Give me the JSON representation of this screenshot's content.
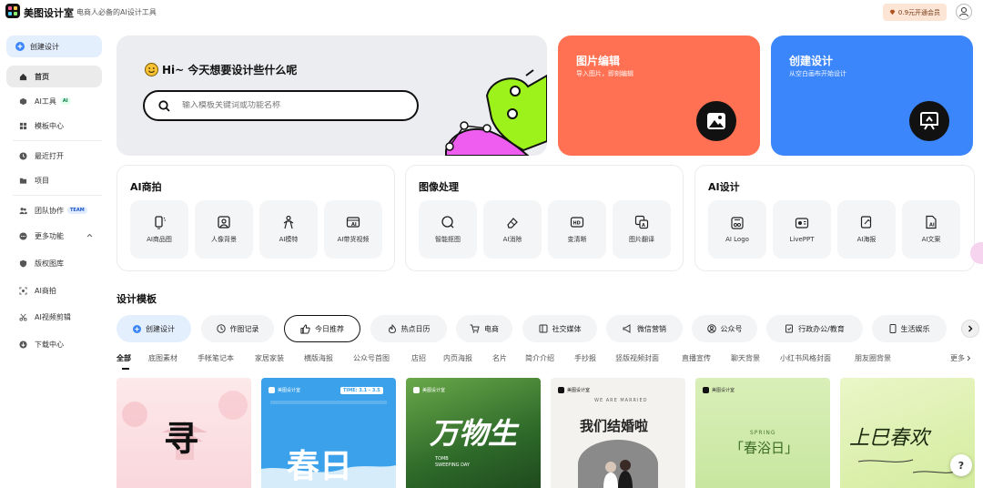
{
  "topbar": {
    "brand": "美图设计室",
    "slogan": "电商人必备的AI设计工具",
    "vip_label": "0.9元开通会员"
  },
  "sidebar": {
    "create_label": "创建设计",
    "items": [
      {
        "label": "首页",
        "icon": "home-icon"
      },
      {
        "label": "AI工具",
        "icon": "cube-icon",
        "tag": "AI"
      },
      {
        "label": "模板中心",
        "icon": "grid-icon"
      },
      {
        "label": "最近打开",
        "icon": "clock-icon"
      },
      {
        "label": "项目",
        "icon": "folder-icon"
      },
      {
        "label": "团队协作",
        "icon": "team-icon",
        "tag": "TEAM"
      },
      {
        "label": "更多功能",
        "icon": "more-icon"
      },
      {
        "label": "版权图库",
        "icon": "shield-icon"
      },
      {
        "label": "AI商拍",
        "icon": "scan-icon"
      },
      {
        "label": "AI视频剪辑",
        "icon": "scissors-icon"
      },
      {
        "label": "下载中心",
        "icon": "download-icon"
      }
    ]
  },
  "hero": {
    "title": "Hi~ 今天想要设计些什么呢",
    "search_placeholder": "输入模板关键词或功能名称"
  },
  "cards": [
    {
      "title": "图片编辑",
      "subtitle": "导入图片，即刻编辑",
      "color": "#ff7152",
      "icon": "image-icon"
    },
    {
      "title": "创建设计",
      "subtitle": "从空白画布开始设计",
      "color": "#3b86fb",
      "icon": "canvas-icon"
    }
  ],
  "panels": [
    {
      "title": "AI商拍",
      "tools": [
        "AI商品图",
        "人像背景",
        "AI模特",
        "AI带货视频"
      ]
    },
    {
      "title": "图像处理",
      "tools": [
        "智能抠图",
        "AI消除",
        "变清晰",
        "图片翻译"
      ]
    },
    {
      "title": "AI设计",
      "tools": [
        "AI Logo",
        "LivePPT",
        "AI海报",
        "AI文案"
      ]
    }
  ],
  "templates": {
    "section_title": "设计模板",
    "pills": [
      "创建设计",
      "作图记录",
      "今日推荐",
      "热点日历",
      "电商",
      "社交媒体",
      "微信营销",
      "公众号",
      "行政办公/教育",
      "生活娱乐"
    ],
    "categories": [
      "全部",
      "底图素材",
      "手帐笔记本",
      "家居家装",
      "横版海报",
      "公众号首图",
      "店招",
      "内页海报",
      "名片",
      "简介介绍",
      "手抄报",
      "竖版视频封面",
      "直播宣传",
      "聊天背景",
      "小红书风格封面",
      "朋友圈背景",
      "更多"
    ],
    "thumbs": [
      {
        "text": "寻",
        "sub": ""
      },
      {
        "text": "春日",
        "sub": "TIME: 3.1 - 3.5"
      },
      {
        "text": "万物生",
        "sub": "TOMB SWEEPING DAY"
      },
      {
        "text": "我们结婚啦",
        "sub": "WE ARE MARRIED"
      },
      {
        "text": "「春浴日」",
        "sub": "SPRING"
      },
      {
        "text": "上巳春欢",
        "sub": ""
      }
    ]
  },
  "colors": {
    "accent_blue": "#3b86fb",
    "accent_orange": "#ff7152",
    "sidebar_active": "#e4effe"
  }
}
